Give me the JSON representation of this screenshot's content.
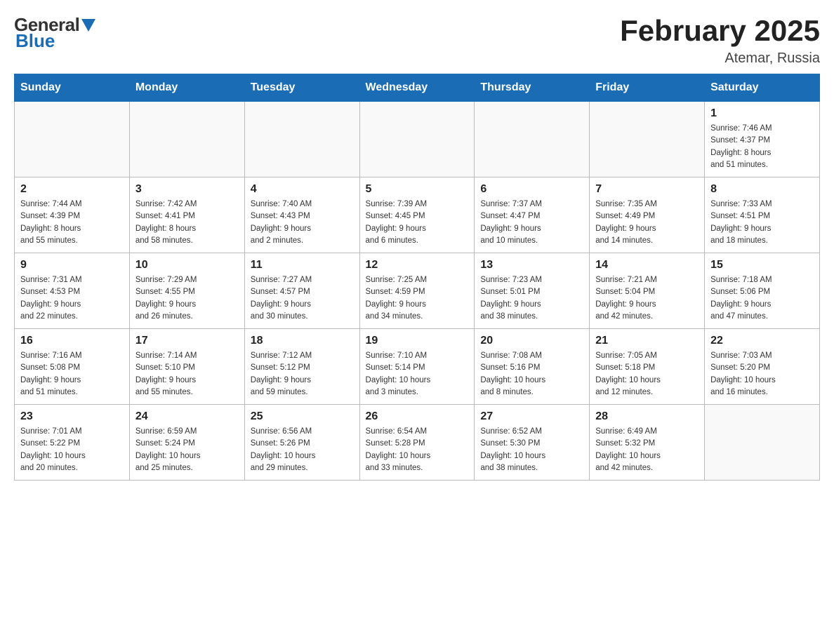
{
  "header": {
    "title": "February 2025",
    "subtitle": "Atemar, Russia"
  },
  "logo": {
    "general": "General",
    "blue": "Blue"
  },
  "weekdays": [
    "Sunday",
    "Monday",
    "Tuesday",
    "Wednesday",
    "Thursday",
    "Friday",
    "Saturday"
  ],
  "weeks": [
    [
      {
        "day": "",
        "info": ""
      },
      {
        "day": "",
        "info": ""
      },
      {
        "day": "",
        "info": ""
      },
      {
        "day": "",
        "info": ""
      },
      {
        "day": "",
        "info": ""
      },
      {
        "day": "",
        "info": ""
      },
      {
        "day": "1",
        "info": "Sunrise: 7:46 AM\nSunset: 4:37 PM\nDaylight: 8 hours\nand 51 minutes."
      }
    ],
    [
      {
        "day": "2",
        "info": "Sunrise: 7:44 AM\nSunset: 4:39 PM\nDaylight: 8 hours\nand 55 minutes."
      },
      {
        "day": "3",
        "info": "Sunrise: 7:42 AM\nSunset: 4:41 PM\nDaylight: 8 hours\nand 58 minutes."
      },
      {
        "day": "4",
        "info": "Sunrise: 7:40 AM\nSunset: 4:43 PM\nDaylight: 9 hours\nand 2 minutes."
      },
      {
        "day": "5",
        "info": "Sunrise: 7:39 AM\nSunset: 4:45 PM\nDaylight: 9 hours\nand 6 minutes."
      },
      {
        "day": "6",
        "info": "Sunrise: 7:37 AM\nSunset: 4:47 PM\nDaylight: 9 hours\nand 10 minutes."
      },
      {
        "day": "7",
        "info": "Sunrise: 7:35 AM\nSunset: 4:49 PM\nDaylight: 9 hours\nand 14 minutes."
      },
      {
        "day": "8",
        "info": "Sunrise: 7:33 AM\nSunset: 4:51 PM\nDaylight: 9 hours\nand 18 minutes."
      }
    ],
    [
      {
        "day": "9",
        "info": "Sunrise: 7:31 AM\nSunset: 4:53 PM\nDaylight: 9 hours\nand 22 minutes."
      },
      {
        "day": "10",
        "info": "Sunrise: 7:29 AM\nSunset: 4:55 PM\nDaylight: 9 hours\nand 26 minutes."
      },
      {
        "day": "11",
        "info": "Sunrise: 7:27 AM\nSunset: 4:57 PM\nDaylight: 9 hours\nand 30 minutes."
      },
      {
        "day": "12",
        "info": "Sunrise: 7:25 AM\nSunset: 4:59 PM\nDaylight: 9 hours\nand 34 minutes."
      },
      {
        "day": "13",
        "info": "Sunrise: 7:23 AM\nSunset: 5:01 PM\nDaylight: 9 hours\nand 38 minutes."
      },
      {
        "day": "14",
        "info": "Sunrise: 7:21 AM\nSunset: 5:04 PM\nDaylight: 9 hours\nand 42 minutes."
      },
      {
        "day": "15",
        "info": "Sunrise: 7:18 AM\nSunset: 5:06 PM\nDaylight: 9 hours\nand 47 minutes."
      }
    ],
    [
      {
        "day": "16",
        "info": "Sunrise: 7:16 AM\nSunset: 5:08 PM\nDaylight: 9 hours\nand 51 minutes."
      },
      {
        "day": "17",
        "info": "Sunrise: 7:14 AM\nSunset: 5:10 PM\nDaylight: 9 hours\nand 55 minutes."
      },
      {
        "day": "18",
        "info": "Sunrise: 7:12 AM\nSunset: 5:12 PM\nDaylight: 9 hours\nand 59 minutes."
      },
      {
        "day": "19",
        "info": "Sunrise: 7:10 AM\nSunset: 5:14 PM\nDaylight: 10 hours\nand 3 minutes."
      },
      {
        "day": "20",
        "info": "Sunrise: 7:08 AM\nSunset: 5:16 PM\nDaylight: 10 hours\nand 8 minutes."
      },
      {
        "day": "21",
        "info": "Sunrise: 7:05 AM\nSunset: 5:18 PM\nDaylight: 10 hours\nand 12 minutes."
      },
      {
        "day": "22",
        "info": "Sunrise: 7:03 AM\nSunset: 5:20 PM\nDaylight: 10 hours\nand 16 minutes."
      }
    ],
    [
      {
        "day": "23",
        "info": "Sunrise: 7:01 AM\nSunset: 5:22 PM\nDaylight: 10 hours\nand 20 minutes."
      },
      {
        "day": "24",
        "info": "Sunrise: 6:59 AM\nSunset: 5:24 PM\nDaylight: 10 hours\nand 25 minutes."
      },
      {
        "day": "25",
        "info": "Sunrise: 6:56 AM\nSunset: 5:26 PM\nDaylight: 10 hours\nand 29 minutes."
      },
      {
        "day": "26",
        "info": "Sunrise: 6:54 AM\nSunset: 5:28 PM\nDaylight: 10 hours\nand 33 minutes."
      },
      {
        "day": "27",
        "info": "Sunrise: 6:52 AM\nSunset: 5:30 PM\nDaylight: 10 hours\nand 38 minutes."
      },
      {
        "day": "28",
        "info": "Sunrise: 6:49 AM\nSunset: 5:32 PM\nDaylight: 10 hours\nand 42 minutes."
      },
      {
        "day": "",
        "info": ""
      }
    ]
  ]
}
